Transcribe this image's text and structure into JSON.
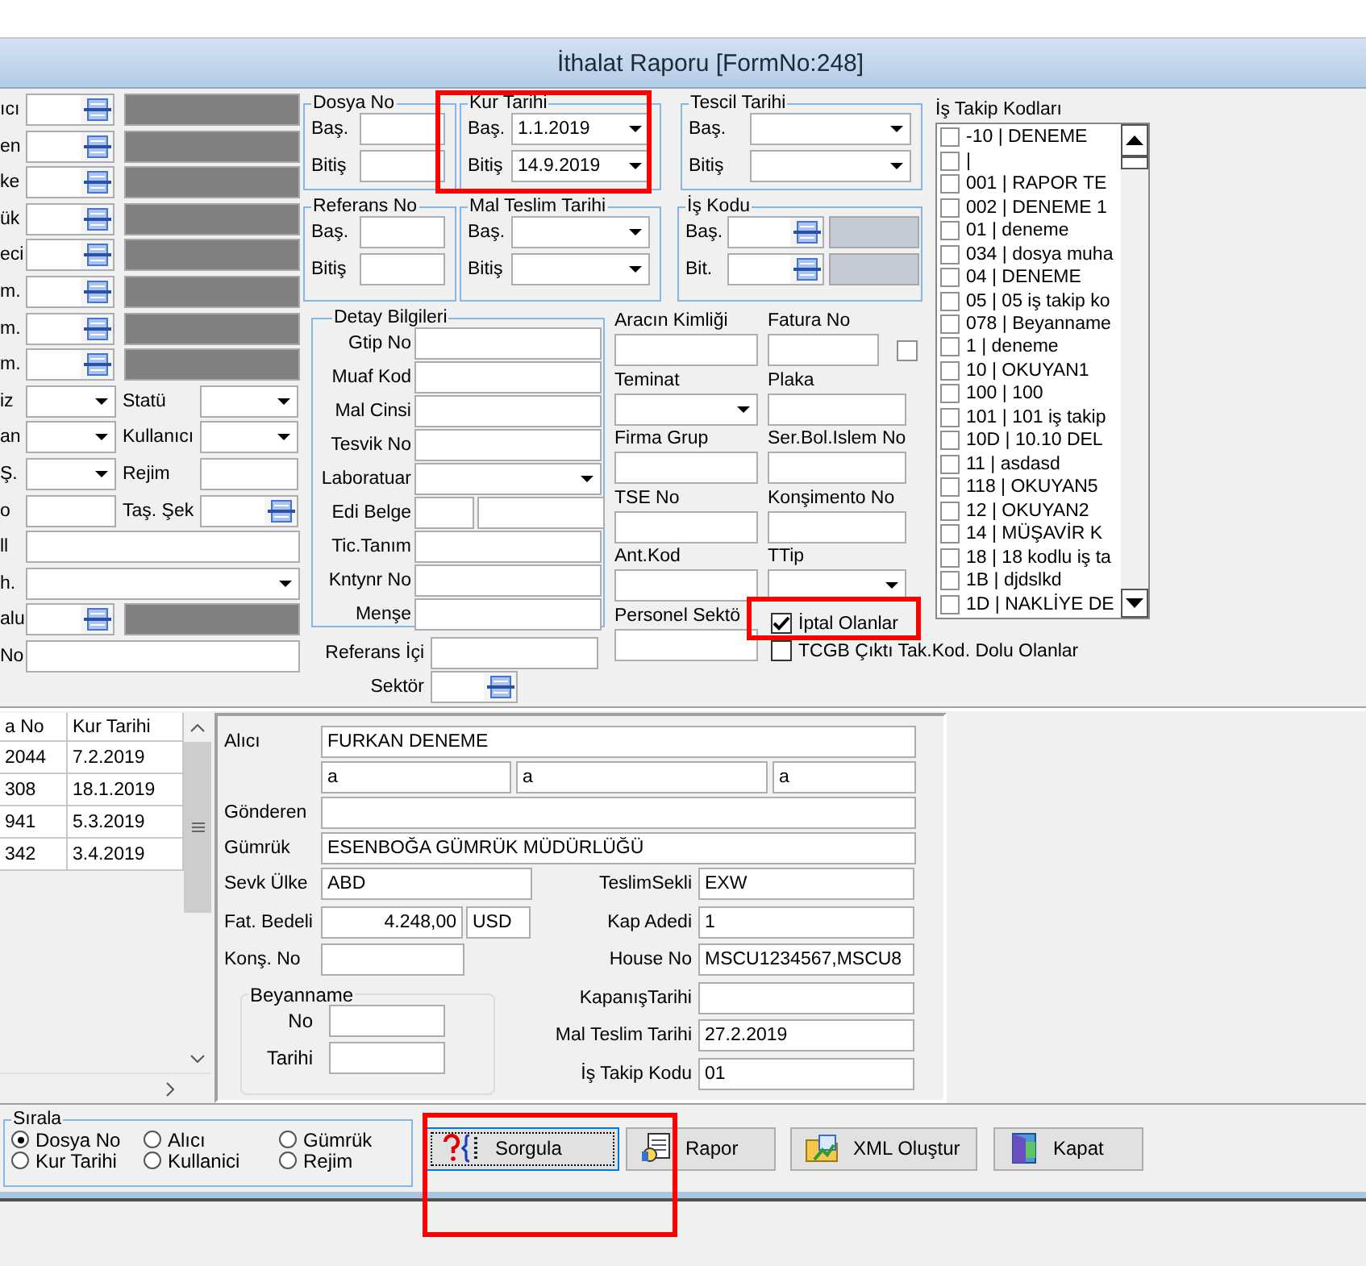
{
  "window": {
    "title": "İthalat Raporu [FormNo:248]"
  },
  "left_filters": [
    {
      "kind": "lookup",
      "label": "ıcı"
    },
    {
      "kind": "lookup",
      "label": "en"
    },
    {
      "kind": "lookup",
      "label": "ke"
    },
    {
      "kind": "lookup",
      "label": "ük"
    },
    {
      "kind": "lookup",
      "label": "eci"
    },
    {
      "kind": "lookup",
      "label": "m."
    },
    {
      "kind": "lookup",
      "label": "m."
    },
    {
      "kind": "lookup",
      "label": "m."
    },
    {
      "kind": "combo_combo",
      "label": "iz",
      "label_2": "Statü"
    },
    {
      "kind": "combo_combo",
      "label": "an",
      "label_2": "Kullanıcı"
    },
    {
      "kind": "combo_input",
      "label": "Ş.",
      "label_2": "Rejim"
    },
    {
      "kind": "input_lookup",
      "label": "o",
      "label_2": "Taş. Şek"
    },
    {
      "kind": "wide_input",
      "label": "ll"
    },
    {
      "kind": "wide_combo",
      "label": "h."
    },
    {
      "kind": "lookup",
      "label": "alu"
    },
    {
      "kind": "wide_input",
      "label": "No"
    }
  ],
  "range_groups": [
    [
      {
        "title": "Dosya No",
        "kind": "text",
        "rows": [
          {
            "label": "Baş."
          },
          {
            "label": "Bitiş"
          }
        ]
      },
      {
        "title": "Kur Tarihi",
        "kind": "date",
        "rows": [
          {
            "label": "Baş.",
            "value": "1.1.2019"
          },
          {
            "label": "Bitiş",
            "value": "14.9.2019"
          }
        ]
      },
      {
        "title": "Tescil Tarihi",
        "kind": "date",
        "rows": [
          {
            "label": "Baş."
          },
          {
            "label": "Bitiş"
          }
        ]
      }
    ],
    [
      {
        "title": "Referans No",
        "kind": "text",
        "rows": [
          {
            "label": "Baş."
          },
          {
            "label": "Bitiş"
          }
        ]
      },
      {
        "title": "Mal Teslim Tarihi",
        "kind": "date",
        "rows": [
          {
            "label": "Baş."
          },
          {
            "label": "Bitiş"
          }
        ]
      },
      {
        "title": "İş Kodu",
        "kind": "lookup",
        "rows": [
          {
            "label": "Baş."
          },
          {
            "label": "Bit."
          }
        ]
      }
    ]
  ],
  "detay": {
    "title": "Detay Bilgileri",
    "rows": [
      {
        "label": "Gtip No",
        "kind": "text"
      },
      {
        "label": "Muaf Kod",
        "kind": "text"
      },
      {
        "label": "Mal Cinsi",
        "kind": "text"
      },
      {
        "label": "Tesvik No",
        "kind": "text"
      },
      {
        "label": "Laboratuar",
        "kind": "combo"
      },
      {
        "label": "Edi Belge",
        "kind": "split"
      },
      {
        "label": "Tic.Tanım",
        "kind": "text"
      },
      {
        "label": "Kntynr No",
        "kind": "text"
      },
      {
        "label": "Menşe",
        "kind": "text"
      }
    ]
  },
  "extra_rows": [
    {
      "label": "Referans İçi",
      "kind": "text"
    },
    {
      "label": "Sektör",
      "kind": "lookup"
    }
  ],
  "mid_fields": [
    {
      "label": "Aracın Kimliği",
      "kind": "text"
    },
    {
      "label": "Fatura No",
      "kind": "text_check",
      "checked": false
    },
    {
      "label": "Teminat",
      "kind": "combo"
    },
    {
      "label": "Plaka",
      "kind": "text"
    },
    {
      "label": "Firma Grup",
      "kind": "text"
    },
    {
      "label": "Ser.Bol.Islem No",
      "kind": "text"
    },
    {
      "label": "TSE No",
      "kind": "text"
    },
    {
      "label": "Konşimento No",
      "kind": "text"
    },
    {
      "label": "Ant.Kod",
      "kind": "text"
    },
    {
      "label": "TTip",
      "kind": "combo"
    },
    {
      "label": "Personel Sektö",
      "kind": "text"
    }
  ],
  "options": [
    {
      "label": "İptal Olanlar",
      "checked": true
    },
    {
      "label": "TCGB Çıktı Tak.Kod. Dolu Olanlar",
      "checked": false
    }
  ],
  "is_takip": {
    "title": "İş Takip Kodları",
    "items": [
      {
        "label": "-10 | DENEME",
        "checked": false
      },
      {
        "label": "|",
        "checked": false
      },
      {
        "label": "001 | RAPOR TE",
        "checked": false
      },
      {
        "label": "002 | DENEME 1",
        "checked": false
      },
      {
        "label": "01 | deneme",
        "checked": false
      },
      {
        "label": "034 | dosya muha",
        "checked": false
      },
      {
        "label": "04 | DENEME",
        "checked": false
      },
      {
        "label": "05 | 05 iş takip ko",
        "checked": false
      },
      {
        "label": "078 | Beyanname",
        "checked": false
      },
      {
        "label": "1 | deneme",
        "checked": false
      },
      {
        "label": "10 | OKUYAN1",
        "checked": false
      },
      {
        "label": "100 | 100",
        "checked": false
      },
      {
        "label": "101 | 101 iş takip",
        "checked": false
      },
      {
        "label": "10D | 10.10 DEL",
        "checked": false
      },
      {
        "label": "11 | asdasd",
        "checked": false
      },
      {
        "label": "118 | OKUYAN5",
        "checked": false
      },
      {
        "label": "12 | OKUYAN2",
        "checked": false
      },
      {
        "label": "14 | MÜŞAVİR K",
        "checked": false
      },
      {
        "label": "18 | 18 kodlu iş ta",
        "checked": false
      },
      {
        "label": "1B | djdslkd",
        "checked": false
      },
      {
        "label": "1D | NAKLİYE DE",
        "checked": false
      }
    ]
  },
  "table": {
    "columns": [
      "a No",
      "Kur Tarihi"
    ],
    "rows": [
      [
        "2044",
        "7.2.2019"
      ],
      [
        "308",
        "18.1.2019"
      ],
      [
        "941",
        "5.3.2019"
      ],
      [
        "342",
        "3.4.2019"
      ]
    ]
  },
  "detail": {
    "top_rows": [
      {
        "label": "Alıcı",
        "value": "FURKAN DENEME"
      },
      {
        "values": [
          "a",
          "a",
          "a"
        ]
      },
      {
        "label": "Gönderen"
      },
      {
        "label": "Gümrük",
        "value": "ESENBOĞA GÜMRÜK MÜDÜRLÜĞÜ"
      }
    ],
    "left_rows": [
      {
        "label": "Sevk Ülke",
        "kind": "text",
        "value": "ABD"
      },
      {
        "label": "Fat. Bedeli",
        "kind": "amount",
        "value": "4.248,00",
        "currency": "USD"
      },
      {
        "label": "Konş. No",
        "kind": "short"
      }
    ],
    "beyanname": {
      "title": "Beyanname",
      "rows": [
        {
          "label": "No"
        },
        {
          "label": "Tarihi"
        }
      ]
    },
    "right_rows": [
      {
        "label": "TeslimSekli",
        "value": "EXW"
      },
      {
        "label": "Kap Adedi",
        "value": "1"
      },
      {
        "label": "House No",
        "value": "MSCU1234567,MSCU8"
      },
      {
        "label": "KapanışTarihi"
      },
      {
        "label": "Mal Teslim Tarihi",
        "value": "27.2.2019"
      },
      {
        "label": "İş Takip Kodu",
        "value": "01"
      }
    ]
  },
  "sort": {
    "title": "Sırala",
    "options": [
      {
        "label": "Dosya No",
        "selected": true
      },
      {
        "label": "Alıcı",
        "selected": false
      },
      {
        "label": "Gümrük",
        "selected": false
      },
      {
        "label": "Kur Tarihi",
        "selected": false
      },
      {
        "label": "Kullanici",
        "selected": false
      },
      {
        "label": "Rejim",
        "selected": false
      }
    ]
  },
  "buttons": [
    {
      "label": "Sorgula",
      "kind": "query",
      "focused": true
    },
    {
      "label": "Rapor",
      "kind": "report",
      "focused": false
    },
    {
      "label": "XML Oluştur",
      "kind": "xml",
      "focused": false
    },
    {
      "label": "Kapat",
      "kind": "close",
      "focused": false
    }
  ]
}
